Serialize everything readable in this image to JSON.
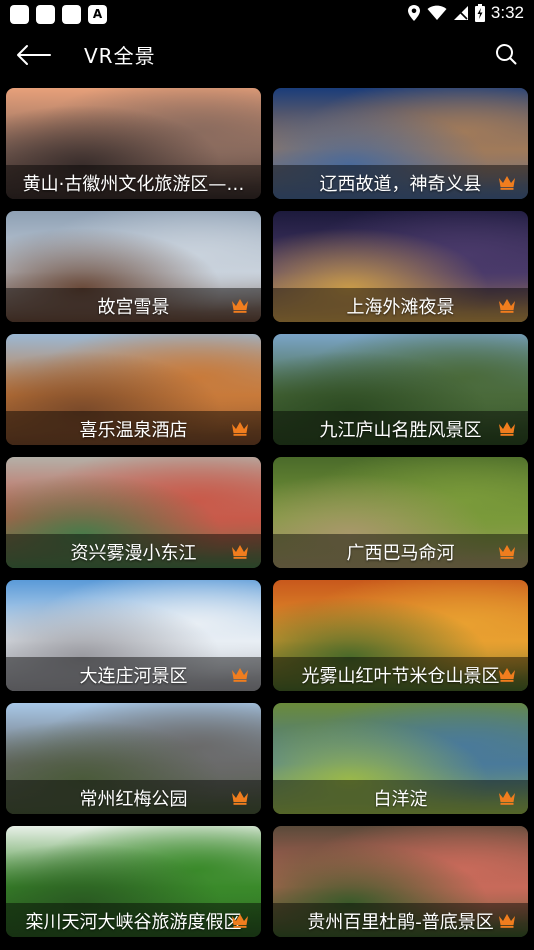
{
  "status": {
    "time": "3:32"
  },
  "header": {
    "title": "VR全景"
  },
  "accent": "#f07d1e",
  "scenes": [
    {
      "title": "黄山·古徽州文化旅游区——",
      "vip": false,
      "display": "黄山·古徽州文化旅游区—…",
      "colors": [
        "#e7a07a",
        "#8a6b5e",
        "#3a2e2c"
      ]
    },
    {
      "title": "辽西故道，神奇义县",
      "vip": true,
      "colors": [
        "#1a3c7a",
        "#a07a5a",
        "#4a6a9a"
      ]
    },
    {
      "title": "故宫雪景",
      "vip": true,
      "colors": [
        "#8ea0b4",
        "#c9d2dc",
        "#6a4a3a"
      ]
    },
    {
      "title": "上海外滩夜景",
      "vip": true,
      "colors": [
        "#1c1a3c",
        "#4a3a6a",
        "#c89a4a"
      ]
    },
    {
      "title": "喜乐温泉酒店",
      "vip": true,
      "colors": [
        "#9ab8d4",
        "#c87a3a",
        "#7a4a2a"
      ]
    },
    {
      "title": "九江庐山名胜风景区",
      "vip": true,
      "colors": [
        "#7aa4c8",
        "#4a6a3a",
        "#2c4a22"
      ]
    },
    {
      "title": "资兴雾漫小东江",
      "vip": true,
      "colors": [
        "#b4b0a8",
        "#c85a4a",
        "#4a7a4a"
      ]
    },
    {
      "title": "广西巴马命河",
      "vip": true,
      "colors": [
        "#4a6a2a",
        "#7a9a3a",
        "#a8986a"
      ]
    },
    {
      "title": "大连庄河景区",
      "vip": true,
      "colors": [
        "#5a9ad8",
        "#e8eef4",
        "#9a9aa0"
      ]
    },
    {
      "title": "光雾山红叶节米仓山景区",
      "vip": true,
      "colors": [
        "#c8581c",
        "#e8a030",
        "#4a6a2a"
      ]
    },
    {
      "title": "常州红梅公园",
      "vip": true,
      "colors": [
        "#a8c8e8",
        "#6a6a6a",
        "#4a5a3a"
      ]
    },
    {
      "title": "白洋淀",
      "vip": true,
      "colors": [
        "#6a8a3a",
        "#4a7a9a",
        "#9ab84a"
      ]
    },
    {
      "title": "栾川天河大峡谷旅游度假区",
      "vip": true,
      "colors": [
        "#e8f0e8",
        "#3a8a2a",
        "#2a5a22"
      ]
    },
    {
      "title": "贵州百里杜鹃-普底景区",
      "vip": true,
      "colors": [
        "#5a4a3a",
        "#c86a5a",
        "#3a5a2a"
      ]
    }
  ]
}
